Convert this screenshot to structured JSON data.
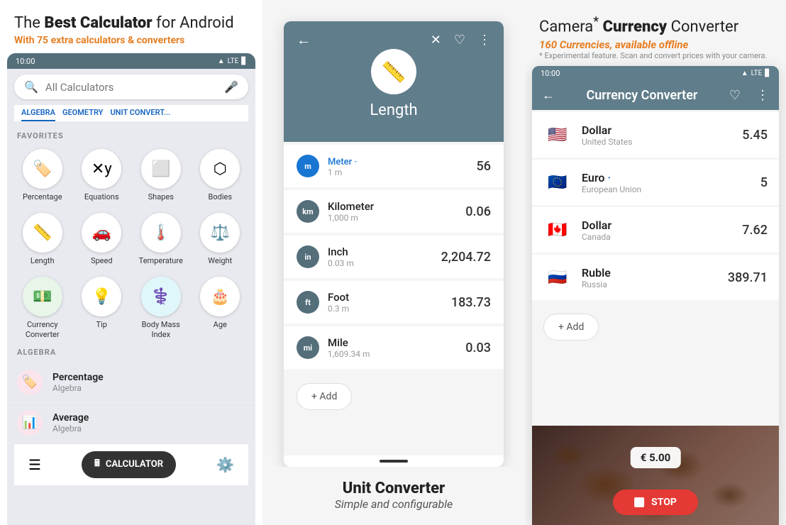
{
  "panel1": {
    "title_pre": "The ",
    "title_bold": "Best Calculator",
    "title_post": " for Android",
    "subtitle_pre": "With ",
    "subtitle_num": "75",
    "subtitle_post": " extra calculators & converters",
    "status_time": "10:00",
    "status_signal": "▲ LTE ▊",
    "search_placeholder": "All Calculators",
    "tabs": [
      "ALGEBRA",
      "GEOMETRY",
      "UNIT CONVERT..."
    ],
    "favorites_label": "FAVORITES",
    "favorites": [
      {
        "icon": "🏷️",
        "label": "Percentage",
        "color": "#e53935"
      },
      {
        "icon": "✕+▪",
        "label": "Equations",
        "color": "#1565c0"
      },
      {
        "icon": "◻",
        "label": "Shapes",
        "color": "#f9a825"
      },
      {
        "icon": "⬡",
        "label": "Bodies",
        "color": "#f9a825"
      },
      {
        "icon": "📏",
        "label": "Length",
        "color": "#1565c0"
      },
      {
        "icon": "🚗",
        "label": "Speed",
        "color": "#1565c0"
      },
      {
        "icon": "🌡️",
        "label": "Temperature",
        "color": "#1565c0"
      },
      {
        "icon": "⚖️",
        "label": "Weight",
        "color": "#1565c0"
      },
      {
        "icon": "💵",
        "label": "Currency\nConverter",
        "color": "#43a047"
      },
      {
        "icon": "💡",
        "label": "Tip",
        "color": "#43a047"
      },
      {
        "icon": "⚕️",
        "label": "Body Mass\nIndex",
        "color": "#00acc1"
      },
      {
        "icon": "🎂",
        "label": "Age",
        "color": "#9c27b0"
      }
    ],
    "algebra_label": "ALGEBRA",
    "algebra_items": [
      {
        "name": "Percentage",
        "sub": "Algebra",
        "bg": "#e53935",
        "icon": "🏷️"
      },
      {
        "name": "Average",
        "sub": "Algebra",
        "bg": "#e91e63",
        "icon": "📊"
      }
    ],
    "calc_btn": "CALCULATOR"
  },
  "panel2": {
    "unit_title": "Length",
    "units": [
      {
        "abbr": "m",
        "name": "Meter",
        "dot": "·",
        "sub": "1 m",
        "value": "56"
      },
      {
        "abbr": "km",
        "name": "Kilometer",
        "dot": "",
        "sub": "1,000 m",
        "value": "0.06"
      },
      {
        "abbr": "in",
        "name": "Inch",
        "dot": "",
        "sub": "0.03 m",
        "value": "2,204.72"
      },
      {
        "abbr": "ft",
        "name": "Foot",
        "dot": "",
        "sub": "0.3 m",
        "value": "183.73"
      },
      {
        "abbr": "mi",
        "name": "Mile",
        "dot": "",
        "sub": "1,609.34 m",
        "value": "0.03"
      }
    ],
    "add_label": "+ Add",
    "footer_title": "Unit Converter",
    "footer_sub": "Simple and configurable"
  },
  "panel3": {
    "title_pre": "Camera",
    "title_asterisk": "*",
    "title_bold": " Currency",
    "title_post": " Converter",
    "subtitle": "160 Currencies, available offline",
    "note": "* Experimental feature. Scan and convert prices with your camera.",
    "status_time": "10:00",
    "status_signal": "▲ LTE ▊",
    "topbar_title": "Currency Converter",
    "currencies": [
      {
        "flag": "🇺🇸",
        "name": "Dollar",
        "country": "United States",
        "value": "5.45"
      },
      {
        "flag": "🇪🇺",
        "name": "Euro",
        "dot": "·",
        "country": "European Union",
        "value": "5"
      },
      {
        "flag": "🇨🇦",
        "name": "Dollar",
        "country": "Canada",
        "value": "7.62"
      },
      {
        "flag": "🇷🇺",
        "name": "Ruble",
        "country": "Russia",
        "value": "389.71"
      }
    ],
    "add_label": "+ Add",
    "price_badge": "€ 5.00",
    "stop_btn": "STOP"
  }
}
